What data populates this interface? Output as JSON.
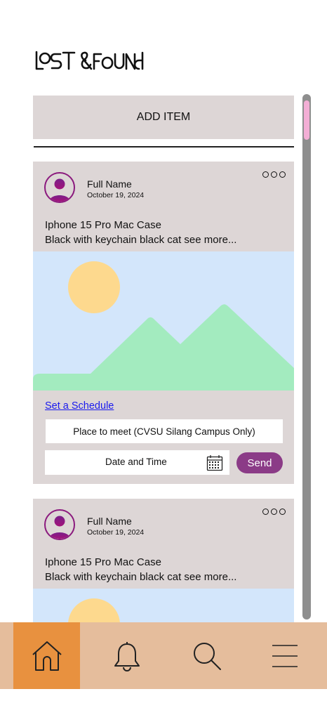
{
  "app": {
    "logo_text": "LOST&FOUND"
  },
  "add_item": {
    "label": "ADD ITEM"
  },
  "posts": [
    {
      "author": "Full Name",
      "date": "October 19, 2024",
      "title": "Iphone 15 Pro Mac Case",
      "description": "Black with keychain black cat see more...",
      "schedule_link": "Set a Schedule",
      "place_placeholder": "Place to meet (CVSU Silang Campus Only)",
      "datetime_placeholder": "Date and Time",
      "send_label": "Send"
    },
    {
      "author": "Full Name",
      "date": "October 19, 2024",
      "title": "Iphone 15 Pro Mac Case",
      "description": "Black with keychain black cat see more..."
    }
  ],
  "nav": {
    "items": [
      {
        "icon": "home-icon",
        "active": true
      },
      {
        "icon": "bell-icon",
        "active": false
      },
      {
        "icon": "search-icon",
        "active": false
      },
      {
        "icon": "menu-icon",
        "active": false
      }
    ]
  },
  "colors": {
    "card_bg": "#ddd6d6",
    "accent_purple": "#8b3b87",
    "avatar_purple": "#8b1a7e",
    "nav_bg": "#e5bd9c",
    "nav_active": "#e8913f",
    "scroll_thumb": "#f3aed5",
    "placeholder_sky": "#d3e6fb",
    "placeholder_sun": "#fdd98e",
    "placeholder_hills": "#a3ebbf"
  }
}
